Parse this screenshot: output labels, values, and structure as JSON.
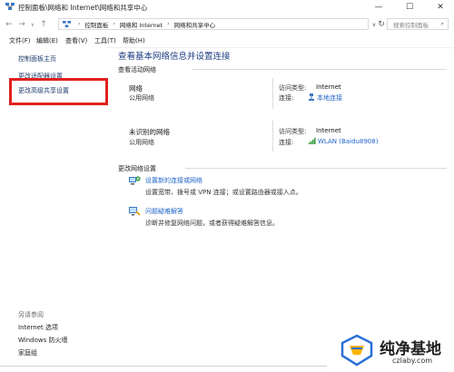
{
  "window": {
    "title": "控制面板\\网络和 Internet\\网络和共享中心",
    "minimize_glyph": "—",
    "maximize_glyph": "☐",
    "close_glyph": "✕"
  },
  "address": {
    "segments": [
      "控制面板",
      "网络和 Internet",
      "网络和共享中心"
    ],
    "search_placeholder": "搜索控制面板"
  },
  "menu": [
    "文件(F)",
    "编辑(E)",
    "查看(V)",
    "工具(T)",
    "帮助(H)"
  ],
  "sidebar": {
    "links": [
      "控制面板主页",
      "更改适配器设置",
      "更改高级共享设置"
    ],
    "see_also_header": "另请参阅",
    "see_also": [
      "Internet 选项",
      "Windows 防火墙",
      "家庭组"
    ]
  },
  "main": {
    "title": "查看基本网络信息并设置连接",
    "active_header": "查看活动网络",
    "networks": [
      {
        "name": "网络",
        "type": "公用网络",
        "access_label": "访问类型:",
        "access_value": "Internet",
        "conn_label": "连接:",
        "conn_value": "本地连接",
        "conn_icon": "ethernet-icon"
      },
      {
        "name": "未识别的网络",
        "type": "公用网络",
        "access_label": "访问类型:",
        "access_value": "Internet",
        "conn_label": "连接:",
        "conn_value": "WLAN (Baidu8908)",
        "conn_icon": "wifi-signal-icon"
      }
    ],
    "change_header": "更改网络设置",
    "tasks": [
      {
        "title": "设置新的连接或网络",
        "desc": "设置宽带、拨号或 VPN 连接；或设置路由器或接入点。",
        "icon": "new-connection-icon"
      },
      {
        "title": "问题疑难解答",
        "desc": "诊断并修复网络问题，或者获得疑难解答信息。",
        "icon": "troubleshoot-icon"
      }
    ]
  },
  "watermark": {
    "title": "纯净基地",
    "url": "czlaby.com"
  }
}
